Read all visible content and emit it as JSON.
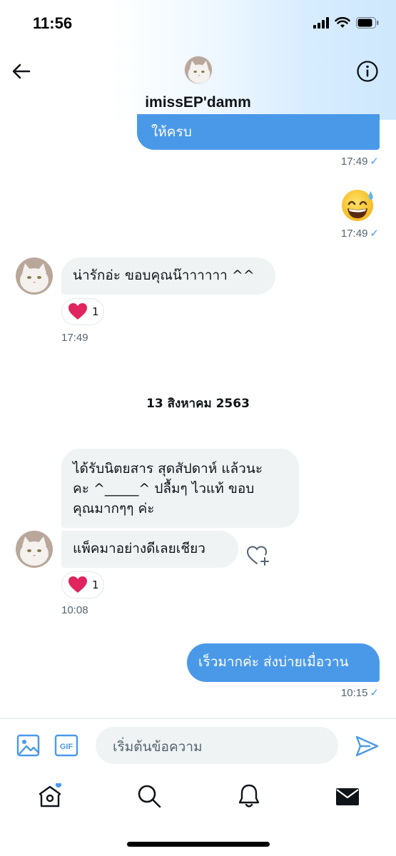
{
  "status_bar": {
    "time": "11:56"
  },
  "header": {
    "contact_name": "imissEP'damm"
  },
  "messages": {
    "out1": {
      "text": "ให้ครบ",
      "time": "17:49"
    },
    "out_emoji": {
      "emoji": "😅",
      "time": "17:49"
    },
    "in1": {
      "text": "น่ารักอ่ะ ขอบคุณน๊าาาาาา ^^",
      "reaction_count": "1",
      "time": "17:49"
    },
    "date_separator": "13 สิงหาคม 2563",
    "in2": {
      "lines": [
        "ได้รับนิตยสาร สุดสัปดาห์ แล้วนะ",
        "คะ ^_____^ ปลื้มๆ ไวแท้  ขอบ",
        "คุณมากๆๆ ค่ะ"
      ]
    },
    "in3": {
      "text": "แพ็คมาอย่างดีเลยเชียว",
      "reaction_count": "1",
      "time": "10:08"
    },
    "out2": {
      "text": "เร็วมากค่ะ ส่งบ่ายเมื่อวาน",
      "time": "10:15"
    }
  },
  "composer": {
    "placeholder": "เริ่มต้นข้อความ"
  },
  "colors": {
    "accent": "#4a99e9",
    "incoming_bubble": "#eff3f4",
    "heart": "#e0245e"
  },
  "icons": [
    "back-arrow-icon",
    "info-icon",
    "image-icon",
    "gif-icon",
    "send-icon",
    "home-icon",
    "search-icon",
    "bell-icon",
    "mail-icon",
    "add-reaction-icon",
    "heart-icon"
  ]
}
